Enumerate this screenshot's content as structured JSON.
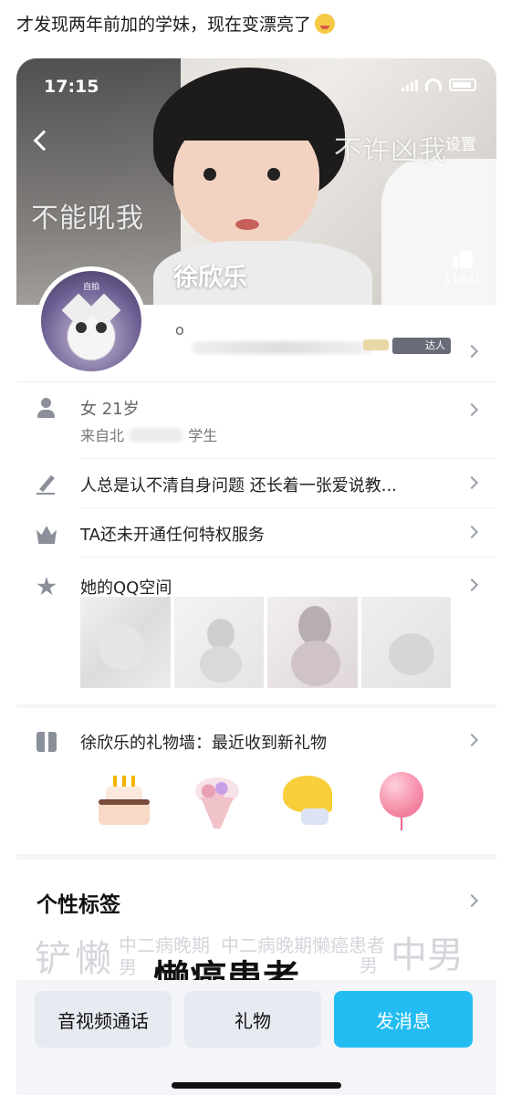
{
  "caption": {
    "text": "才发现两年前加的学妹，现在变漂亮了",
    "emoji": "yum-emoji"
  },
  "status_bar": {
    "time": "17:15",
    "icons": [
      "signal-icon",
      "wifi-icon",
      "battery-icon"
    ]
  },
  "header": {
    "settings_label": "设置",
    "likes": "11841",
    "overlay_left": "不能吼我",
    "overlay_right": "不许凶我"
  },
  "profile": {
    "name": "徐欣乐",
    "avatar_tag": "自拍",
    "level_dot": "o",
    "badge": "达人"
  },
  "info": {
    "basic_line1": "女 21岁",
    "basic_line2": "来自北",
    "basic_line2_tail": "学生",
    "signature": "人总是认不清自身问题 还长着一张爱说教...",
    "privilege": "TA还未开通任何特权服务",
    "qzone": "她的QQ空间",
    "gift_wall": "徐欣乐的礼物墙：最近收到新礼物"
  },
  "gifts": [
    "birthday-cake",
    "flower-bouquet",
    "ginkgo-leaf",
    "balloon"
  ],
  "tags": {
    "title": "个性标签",
    "words": [
      {
        "text": "铲",
        "size": 40
      },
      {
        "text": "懒",
        "size": 40
      },
      {
        "text": "中二病晚期",
        "size": 20
      },
      {
        "text": "男",
        "size": 20
      },
      {
        "text": "中二病晚期懒癌患者",
        "size": 20
      },
      {
        "text": "懒癌患者",
        "size": 40
      },
      {
        "text": "男",
        "size": 20
      },
      {
        "text": "中男",
        "size": 40
      }
    ]
  },
  "actions": {
    "call": "音视频通话",
    "gift": "礼物",
    "message": "发消息"
  },
  "colors": {
    "primary": "#22bcf2",
    "button_light": "#e8eaf2",
    "page_bg": "#f4f5f9"
  }
}
